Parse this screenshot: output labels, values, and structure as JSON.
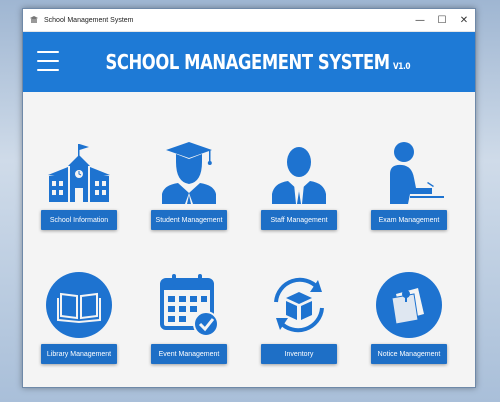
{
  "window": {
    "title": "School Management System",
    "controls": {
      "minimize": "—",
      "maximize": "☐",
      "close": "✕"
    }
  },
  "header": {
    "title": "SCHOOL MANAGEMENT SYSTEM",
    "version": "V1.0"
  },
  "modules": [
    {
      "label": "School Information",
      "icon": "school-building-icon"
    },
    {
      "label": "Student Management",
      "icon": "graduate-student-icon"
    },
    {
      "label": "Staff Management",
      "icon": "staff-person-icon"
    },
    {
      "label": "Exam Management",
      "icon": "exam-writing-icon"
    },
    {
      "label": "Library Management",
      "icon": "open-book-icon"
    },
    {
      "label": "Event Management",
      "icon": "calendar-check-icon"
    },
    {
      "label": "Inventory",
      "icon": "box-cycle-icon"
    },
    {
      "label": "Notice Management",
      "icon": "notice-board-icon"
    }
  ],
  "colors": {
    "header": "#1e7ad6",
    "button": "#1e6fc6",
    "icon": "#1e73d0"
  }
}
